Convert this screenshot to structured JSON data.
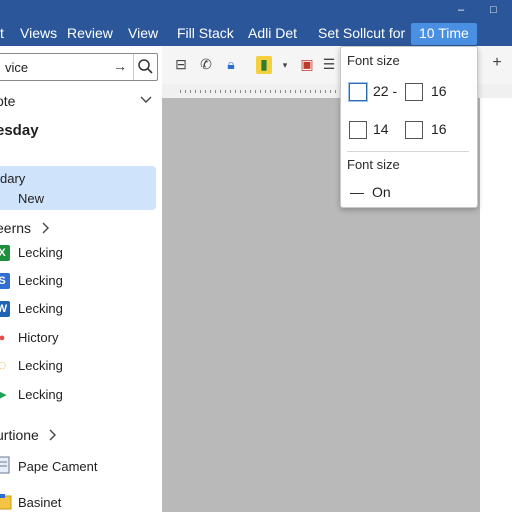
{
  "menubar": {
    "items": [
      "t",
      "Views",
      "Review",
      "View",
      "Fill Stack",
      "Adli Det",
      "Set Sollcut for",
      "10 Time"
    ],
    "active_index": 7,
    "controls": [
      "–",
      "□"
    ]
  },
  "sidebar": {
    "search": {
      "value": "vice"
    },
    "section1": "ote",
    "big_day": "esday",
    "selected": {
      "line1": "dary",
      "line2": "New"
    },
    "items_header": "eerns",
    "items": [
      {
        "label": "Lecking",
        "icon": "spreadsheet-icon",
        "color": "#1e8f3c",
        "glyph": "X"
      },
      {
        "label": "Lecking",
        "icon": "s-app-icon",
        "color": "#2f6fd1",
        "glyph": "S"
      },
      {
        "label": "Lecking",
        "icon": "doc-app-icon",
        "color": "#2163b5",
        "glyph": "W"
      },
      {
        "label": "Hictory",
        "icon": "history-icon",
        "color": "#e24b4b",
        "glyph": "●"
      },
      {
        "label": "Lecking",
        "icon": "sync-icon",
        "color": "#f29a1f",
        "glyph": "◌"
      },
      {
        "label": "Lecking",
        "icon": "play-icon",
        "color": "#22a35a",
        "glyph": "▶"
      }
    ],
    "section2": "urtione",
    "bottom_items": [
      {
        "label": "Pape Cament",
        "icon": "document-icon"
      },
      {
        "label": "Basinet",
        "icon": "folder-icon"
      }
    ]
  },
  "toolbar": {
    "icons": [
      "table-icon",
      "phone-icon",
      "lock-icon",
      "clipboard-icon",
      "dropdown-icon",
      "bookmark-icon",
      "format-icon"
    ],
    "plus": "+"
  },
  "font_popup": {
    "title1": "Font size",
    "options": [
      {
        "label": "22 -",
        "active": true
      },
      {
        "label": "16",
        "active": false
      },
      {
        "label": "14",
        "active": false
      },
      {
        "label": "16",
        "active": false
      }
    ],
    "title2": "Font size",
    "toggle_label": "On"
  }
}
